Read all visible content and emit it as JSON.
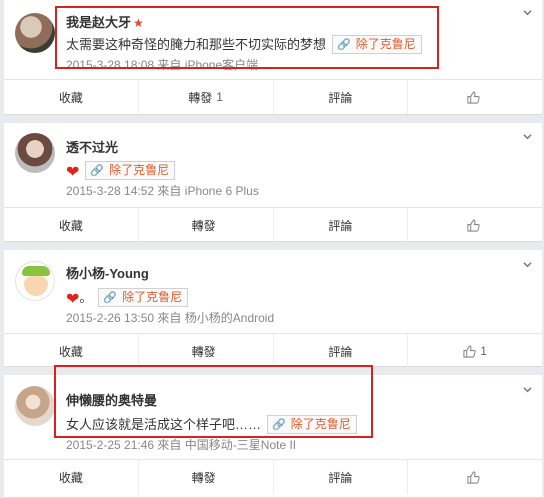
{
  "posts": [
    {
      "username": "我是赵大牙",
      "vip_badge": "★",
      "text": "太需要这种奇怪的腌力和那些不切实际的梦想",
      "tag": "除了克鲁尼",
      "time": "2015-3-28 18:08",
      "via_prefix": "来自",
      "source": "iPhone客户端",
      "actions": {
        "favorite": "收藏",
        "repost": "轉發",
        "repost_count": "1",
        "comment": "評論",
        "like_count": ""
      }
    },
    {
      "username": "透不过光",
      "text": "",
      "tag": "除了克鲁尼",
      "time": "2015-3-28 14:52",
      "via_prefix": "來自",
      "source": "iPhone 6 Plus",
      "actions": {
        "favorite": "收藏",
        "repost": "轉發",
        "repost_count": "",
        "comment": "評論",
        "like_count": ""
      }
    },
    {
      "username": "杨小杨-Young",
      "text": "。",
      "tag": "除了克鲁尼",
      "time": "2015-2-26 13:50",
      "via_prefix": "來自",
      "source": "杨小杨的Android",
      "actions": {
        "favorite": "收藏",
        "repost": "轉發",
        "repost_count": "",
        "comment": "評論",
        "like_count": "1"
      }
    },
    {
      "username": "伸懒腰的奥特曼",
      "text": "女人应该就是活成这个样子吧……",
      "tag": "除了克鲁尼",
      "time": "2015-2-25 21:46",
      "via_prefix": "來自",
      "source": "中国移动-三星Note II",
      "actions": {
        "favorite": "收藏",
        "repost": "轉發",
        "repost_count": "",
        "comment": "評論",
        "like_count": ""
      }
    }
  ],
  "colors": {
    "highlight": "#d9211e",
    "tag_text": "#e45b2b",
    "heart": "#e2231a"
  }
}
